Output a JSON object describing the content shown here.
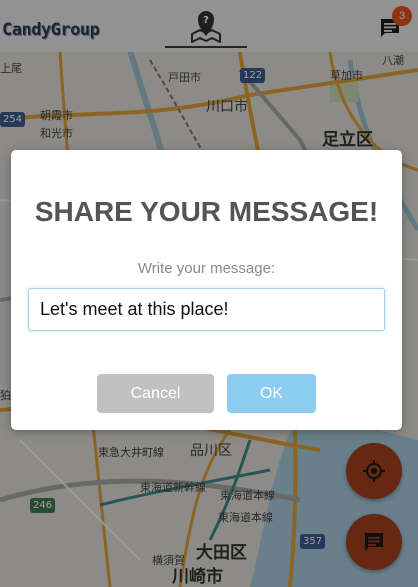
{
  "header": {
    "logo": "CandyGroup",
    "unread_count": "3"
  },
  "map": {
    "labels": {
      "upper_left": "上尾",
      "toda": "戸田市",
      "kusaka": "草加市",
      "yashio": "八潮",
      "asaka": "朝霞市",
      "wako": "和光市",
      "kawaguchi": "川口市",
      "adachi": "足立区",
      "shinagawa": "品川区",
      "tokyu_line": "東急大井町線",
      "tokaido_shinkansen": "東海道新幹線",
      "tokaido_main": "東海道本線",
      "tokaido_right": "東海道本線",
      "yokosuka": "横須賀",
      "ota": "大田区",
      "kawasaki": "川崎市",
      "misc_left": "狛"
    },
    "shields": {
      "r122": "122",
      "r254": "254",
      "r246": "246",
      "r357": "357"
    }
  },
  "dialog": {
    "title": "SHARE YOUR MESSAGE!",
    "label": "Write your message:",
    "input_value": "Let's meet at this place!",
    "cancel_label": "Cancel",
    "ok_label": "OK"
  },
  "colors": {
    "accent_fab": "#a5401f",
    "badge": "#e8531a",
    "ok_button": "#8ccdef",
    "cancel_button": "#c1c1c1"
  },
  "icons": {
    "nav": "map-pin-question-icon",
    "chat": "chat-icon",
    "locate": "crosshair-icon"
  }
}
